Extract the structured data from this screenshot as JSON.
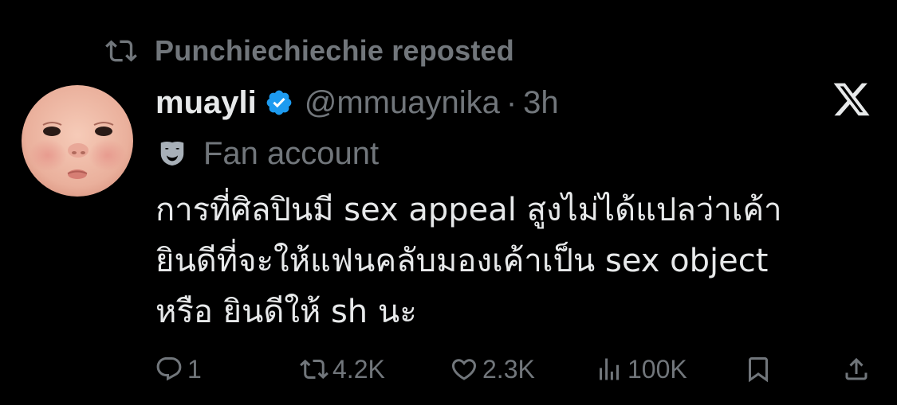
{
  "repost_banner": {
    "icon": "repost-icon",
    "label": "Punchiechiechie reposted"
  },
  "tweet": {
    "avatar": "avatar",
    "display_name": "muayli",
    "verified_icon": "verified-badge-icon",
    "handle": "@mmuaynika",
    "separator": "·",
    "time": "3h",
    "label_icon": "theater-mask-icon",
    "label": "Fan account",
    "text_lines": [
      "การที่ศิลปินมี sex appeal สูงไม่ได้แปลว่าเค้า",
      "ยินดีที่จะให้แฟนคลับมองเค้าเป็น sex object",
      "หรือ ยินดีให้ sh นะ"
    ]
  },
  "brand_icon": "x-logo-icon",
  "actions": {
    "reply": {
      "icon": "reply-icon",
      "count": "1"
    },
    "repost": {
      "icon": "repost-icon",
      "count": "4.2K"
    },
    "like": {
      "icon": "heart-icon",
      "count": "2.3K"
    },
    "views": {
      "icon": "views-chart-icon",
      "count": "100K"
    },
    "bookmark": {
      "icon": "bookmark-icon"
    },
    "share": {
      "icon": "share-icon"
    }
  },
  "colors": {
    "background": "#000000",
    "primary_text": "#e7e9ea",
    "secondary_text": "#71767b",
    "verified_blue": "#1d9bf0"
  }
}
